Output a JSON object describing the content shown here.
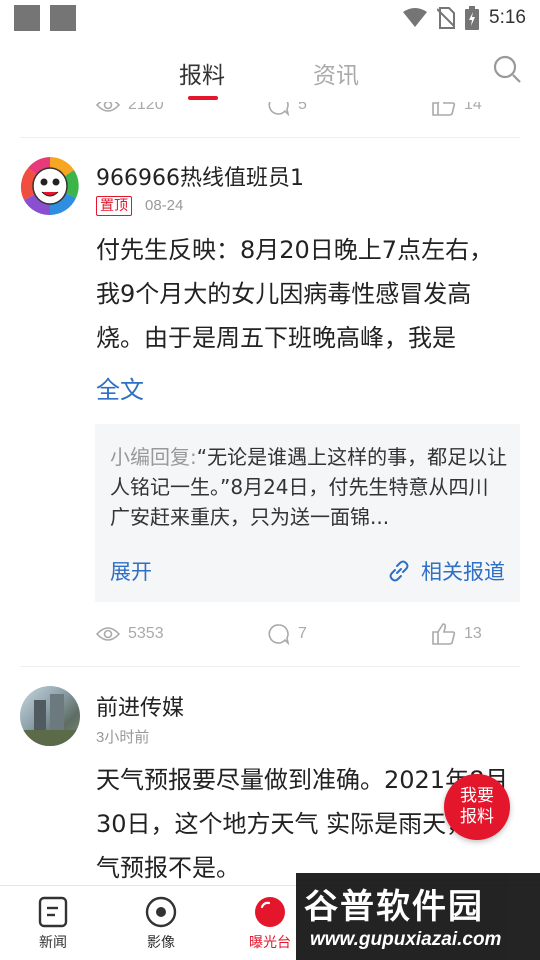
{
  "status_bar": {
    "time": "5:16"
  },
  "header": {
    "tabs": [
      {
        "label": "报料",
        "active": true
      },
      {
        "label": "资讯",
        "active": false
      }
    ],
    "search_icon": "search-icon"
  },
  "feed": {
    "previous_post_stats": {
      "views": "2120",
      "comments": "5",
      "likes": "14"
    },
    "posts": [
      {
        "author": "966966热线值班员1",
        "badge": "置顶",
        "date": "08-24",
        "text": "付先生反映：8月20日晚上7点左右，我9个月大的女儿因病毒性感冒发高烧。由于是周五下班晚高峰，我是",
        "full_text_link": "全文",
        "reply": {
          "prefix": "小编回复:",
          "text": "“无论是谁遇上这样的事，都足以让人铭记一生。”8月24日，付先生特意从四川广安赶来重庆，只为送一面锦...",
          "expand_label": "展开",
          "related_label": "相关报道"
        },
        "stats": {
          "views": "5353",
          "comments": "7",
          "likes": "13"
        }
      },
      {
        "author": "前进传媒",
        "date": "3小时前",
        "text": "天气预报要尽量做到准确。2021年8月30日，这个地方天气 实际是雨天，天气预报不是。"
      }
    ]
  },
  "fab": {
    "line1": "我要",
    "line2": "报料"
  },
  "bottom_nav": {
    "items": [
      {
        "label": "新闻",
        "icon": "news-icon",
        "active": false
      },
      {
        "label": "影像",
        "icon": "video-icon",
        "active": false
      },
      {
        "label": "曝光台",
        "icon": "expose-icon",
        "active": true
      }
    ]
  },
  "watermark": {
    "title": "谷普软件园",
    "url": "www.gupuxiazai.com"
  },
  "colors": {
    "accent": "#e3162b",
    "link": "#2f6fc4"
  }
}
